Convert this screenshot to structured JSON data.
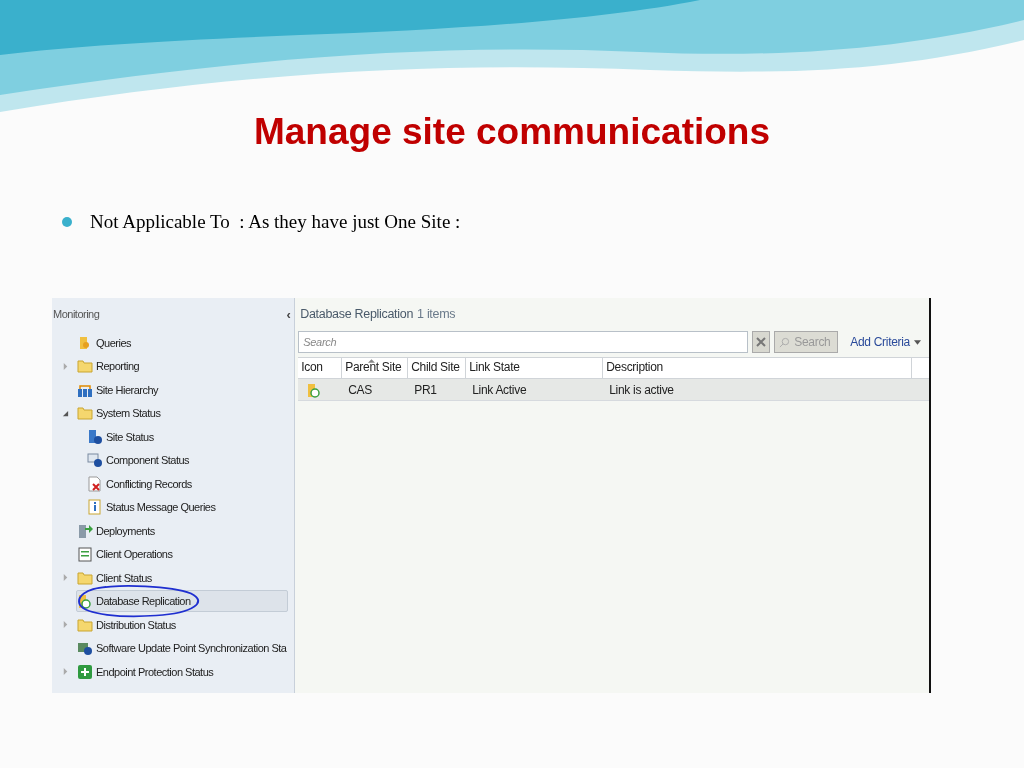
{
  "slide": {
    "title": "Manage site communications",
    "bullets": [
      "Not Applicable To  : As they have just One Site :"
    ]
  },
  "console": {
    "nav": {
      "title": "Monitoring",
      "collapse_glyph": "‹",
      "items": [
        {
          "label": "Queries",
          "kind": "queries",
          "selected": false
        },
        {
          "label": "Reporting",
          "kind": "folder",
          "expanded": false,
          "selected": false
        },
        {
          "label": "Site Hierarchy",
          "kind": "hierarchy",
          "selected": false
        },
        {
          "label": "System Status",
          "kind": "folder",
          "expanded": true,
          "selected": false,
          "children": [
            {
              "label": "Site Status",
              "kind": "site-status",
              "selected": false
            },
            {
              "label": "Component Status",
              "kind": "component",
              "selected": false
            },
            {
              "label": "Conflicting Records",
              "kind": "conflict",
              "selected": false
            },
            {
              "label": "Status Message Queries",
              "kind": "info",
              "selected": false
            }
          ]
        },
        {
          "label": "Deployments",
          "kind": "deployments",
          "selected": false
        },
        {
          "label": "Client Operations",
          "kind": "operations",
          "selected": false
        },
        {
          "label": "Client Status",
          "kind": "folder",
          "expanded": false,
          "selected": false
        },
        {
          "label": "Database Replication",
          "kind": "replication",
          "selected": true
        },
        {
          "label": "Distribution Status",
          "kind": "folder",
          "expanded": false,
          "selected": false
        },
        {
          "label": "Software Update Point Synchronization Sta",
          "kind": "sync",
          "selected": false
        },
        {
          "label": "Endpoint Protection Status",
          "kind": "endpoint",
          "expanded": false,
          "selected": false
        }
      ]
    },
    "content": {
      "title": "Database Replication",
      "count": "1 items",
      "search": {
        "placeholder": "Search"
      },
      "search_button": "Search",
      "add_criteria": "Add Criteria",
      "columns": [
        {
          "label": "Icon",
          "sorted": false
        },
        {
          "label": "Parent Site",
          "sorted": true
        },
        {
          "label": "Child Site",
          "sorted": false
        },
        {
          "label": "Link State",
          "sorted": false
        },
        {
          "label": "Description",
          "sorted": false
        }
      ],
      "rows": [
        {
          "cells": [
            "",
            "CAS",
            "PR1",
            "Link Active",
            "Link is active"
          ],
          "selected": true
        }
      ]
    }
  }
}
